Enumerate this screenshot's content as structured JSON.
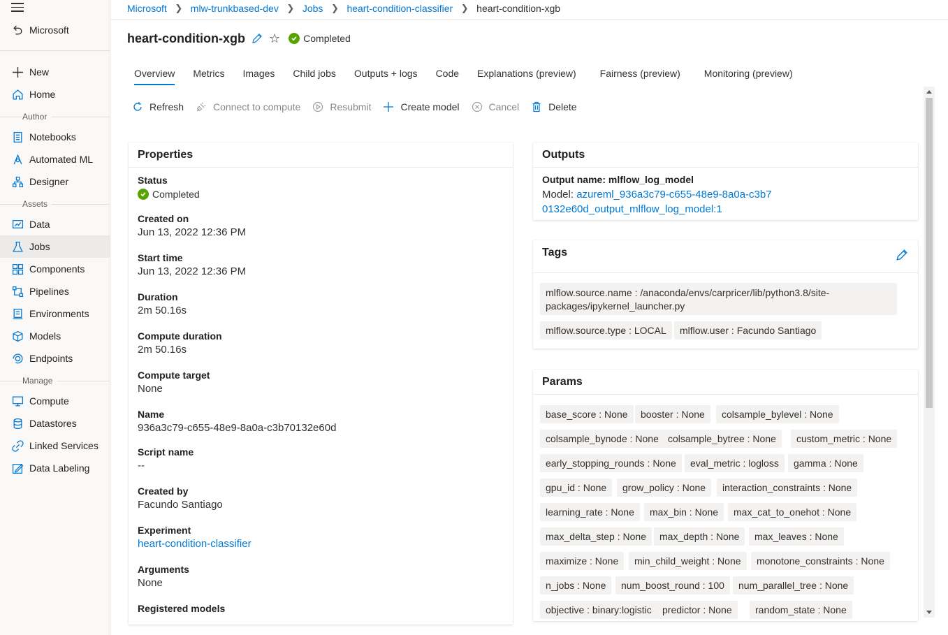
{
  "sidebar": {
    "back_label": "Microsoft",
    "items": [
      {
        "label": "New",
        "icon": "plus-icon"
      },
      {
        "label": "Home",
        "icon": "home-icon"
      },
      {
        "label": "Notebooks",
        "icon": "notebook-icon"
      },
      {
        "label": "Automated ML",
        "icon": "automl-icon"
      },
      {
        "label": "Designer",
        "icon": "designer-icon"
      },
      {
        "label": "Data",
        "icon": "data-icon"
      },
      {
        "label": "Jobs",
        "icon": "flask-icon"
      },
      {
        "label": "Components",
        "icon": "components-icon"
      },
      {
        "label": "Pipelines",
        "icon": "pipelines-icon"
      },
      {
        "label": "Environments",
        "icon": "environments-icon"
      },
      {
        "label": "Models",
        "icon": "cube-icon"
      },
      {
        "label": "Endpoints",
        "icon": "endpoints-icon"
      },
      {
        "label": "Compute",
        "icon": "monitor-icon"
      },
      {
        "label": "Datastores",
        "icon": "database-icon"
      },
      {
        "label": "Linked Services",
        "icon": "link-icon"
      },
      {
        "label": "Data Labeling",
        "icon": "labeling-icon"
      }
    ],
    "sections": {
      "author": "Author",
      "assets": "Assets",
      "manage": "Manage"
    }
  },
  "breadcrumb": [
    "Microsoft",
    "mlw-trunkbased-dev",
    "Jobs",
    "heart-condition-classifier",
    "heart-condition-xgb"
  ],
  "header": {
    "title": "heart-condition-xgb",
    "status": "Completed"
  },
  "tabs": [
    "Overview",
    "Metrics",
    "Images",
    "Child jobs",
    "Outputs + logs",
    "Code",
    "Explanations (preview)",
    "Fairness (preview)",
    "Monitoring (preview)"
  ],
  "toolbar": {
    "refresh": "Refresh",
    "connect": "Connect to compute",
    "resubmit": "Resubmit",
    "create_model": "Create model",
    "cancel": "Cancel",
    "delete": "Delete"
  },
  "properties": {
    "title": "Properties",
    "items": [
      {
        "key": "Status",
        "value": "Completed"
      },
      {
        "key": "Created on",
        "value": "Jun 13, 2022 12:36 PM"
      },
      {
        "key": "Start time",
        "value": "Jun 13, 2022 12:36 PM"
      },
      {
        "key": "Duration",
        "value": "2m 50.16s"
      },
      {
        "key": "Compute duration",
        "value": "2m 50.16s"
      },
      {
        "key": "Compute target",
        "value": "None"
      },
      {
        "key": "Name",
        "value": "936a3c79-c655-48e9-8a0a-c3b70132e60d"
      },
      {
        "key": "Script name",
        "value": "--"
      },
      {
        "key": "Created by",
        "value": "Facundo Santiago"
      },
      {
        "key": "Experiment",
        "value": "heart-condition-classifier"
      },
      {
        "key": "Arguments",
        "value": "None"
      },
      {
        "key": "Registered models",
        "value": ""
      }
    ]
  },
  "outputs": {
    "title": "Outputs",
    "output_name": "Output name: mlflow_log_model",
    "model_label": "Model: ",
    "model_link": "azureml_936a3c79-c655-48e9-8a0a-c3b70132e60d_output_mlflow_log_model:1"
  },
  "tags": {
    "title": "Tags",
    "items": [
      "mlflow.source.name : /anaconda/envs/carpricer/lib/python3.8/site-packages/ipykernel_launcher.py",
      "mlflow.source.type : LOCAL",
      "mlflow.user : Facundo Santiago"
    ]
  },
  "params": {
    "title": "Params",
    "items": [
      "base_score : None",
      "booster : None",
      "colsample_bylevel : None",
      "colsample_bynode : None",
      "colsample_bytree : None",
      "custom_metric : None",
      "early_stopping_rounds : None",
      "eval_metric : logloss",
      "gamma : None",
      "gpu_id : None",
      "grow_policy : None",
      "interaction_constraints : None",
      "learning_rate : None",
      "max_bin : None",
      "max_cat_to_onehot : None",
      "max_delta_step : None",
      "max_depth : None",
      "max_leaves : None",
      "maximize : None",
      "min_child_weight : None",
      "monotone_constraints : None",
      "n_jobs : None",
      "num_boost_round : 100",
      "num_parallel_tree : None",
      "objective : binary:logistic",
      "predictor : None",
      "random_state : None"
    ]
  }
}
